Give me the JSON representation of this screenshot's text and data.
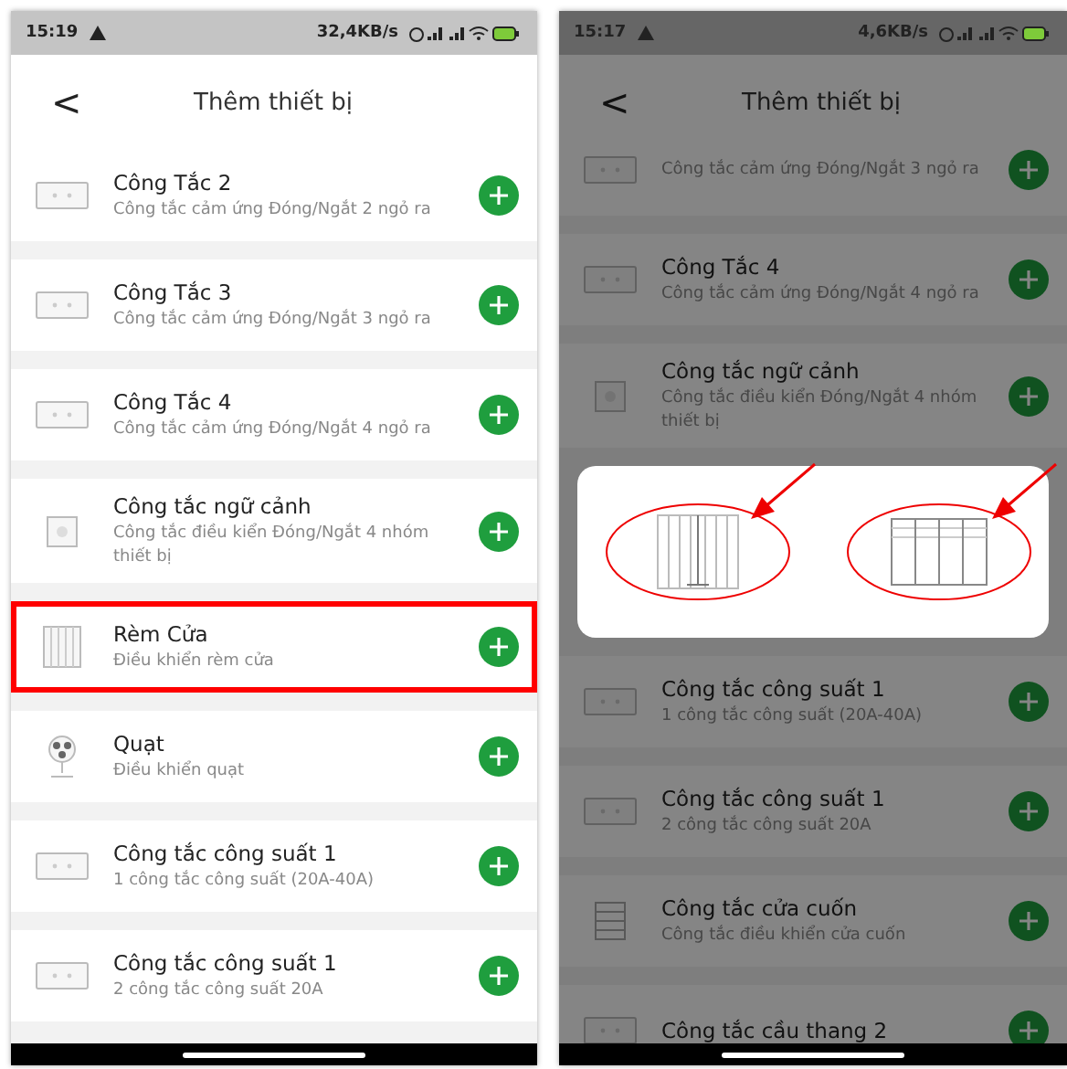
{
  "phones": [
    {
      "status": {
        "time": "15:19",
        "speed": "32,4KB/s"
      },
      "title": "Thêm thiết bị",
      "back": "<",
      "dimmed": false,
      "items": [
        {
          "kind": "switch",
          "title": "Công Tắc 2",
          "subtitle": "Công tắc cảm ứng Đóng/Ngắt 2 ngỏ ra",
          "highlighted": false
        },
        {
          "kind": "switch",
          "title": "Công Tắc 3",
          "subtitle": "Công tắc cảm ứng Đóng/Ngắt 3 ngỏ ra",
          "highlighted": false
        },
        {
          "kind": "switch",
          "title": "Công Tắc 4",
          "subtitle": "Công tắc cảm ứng Đóng/Ngắt 4 ngỏ ra",
          "highlighted": false
        },
        {
          "kind": "scene",
          "title": "Công tắc ngữ cảnh",
          "subtitle": "Công tắc điều kiển Đóng/Ngắt 4 nhóm thiết bị",
          "highlighted": false
        },
        {
          "kind": "curtain",
          "title": "Rèm Cửa",
          "subtitle": "Điều khiển rèm cửa",
          "highlighted": true
        },
        {
          "kind": "fan",
          "title": "Quạt",
          "subtitle": "Điều khiển quạt",
          "highlighted": false
        },
        {
          "kind": "switch",
          "title": "Công tắc công suất 1",
          "subtitle": "1 công tắc công suất (20A-40A)",
          "highlighted": false
        },
        {
          "kind": "switch",
          "title": "Công tắc công suất 1",
          "subtitle": "2 công tắc công suất 20A",
          "highlighted": false
        }
      ]
    },
    {
      "status": {
        "time": "15:17",
        "speed": "4,6KB/s"
      },
      "title": "Thêm thiết bị",
      "back": "<",
      "dimmed": true,
      "items": [
        {
          "kind": "switch",
          "subtitle": "Công tắc cảm ứng Đóng/Ngắt 3 ngỏ ra",
          "highlighted": false
        },
        {
          "kind": "switch",
          "title": "Công Tắc 4",
          "subtitle": "Công tắc cảm ứng Đóng/Ngắt 4 ngỏ ra",
          "highlighted": false
        },
        {
          "kind": "scene",
          "title": "Công tắc ngữ cảnh",
          "subtitle": "Công tắc điều kiển Đóng/Ngắt 4 nhóm thiết bị",
          "highlighted": false
        }
      ],
      "dialog": {
        "options": [
          {
            "kind": "curtain",
            "circled": true
          },
          {
            "kind": "roller",
            "circled": true
          }
        ]
      },
      "items_below": [
        {
          "kind": "switch",
          "title": "Công tắc công suất 1",
          "subtitle": "1 công tắc công suất (20A-40A)",
          "highlighted": false
        },
        {
          "kind": "switch",
          "title": "Công tắc công suất 1",
          "subtitle": "2 công tắc công suất 20A",
          "highlighted": false
        },
        {
          "kind": "rolling",
          "title": "Công tắc cửa cuốn",
          "subtitle": "Công tắc điều khiển cửa cuốn",
          "highlighted": false
        },
        {
          "kind": "switch",
          "title": "Công tắc cầu thang 2",
          "highlighted": false
        }
      ]
    }
  ]
}
